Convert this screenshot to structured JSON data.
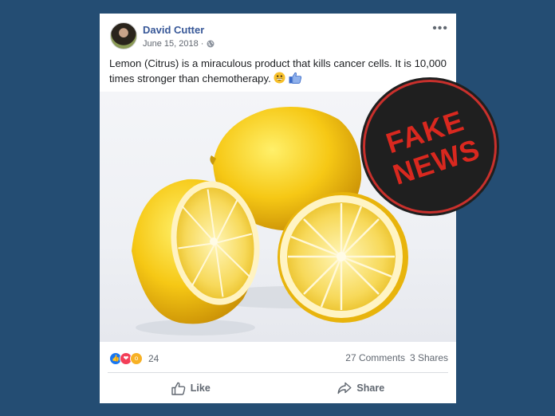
{
  "post": {
    "author": "David Cutter",
    "date": "June 15, 2018 ·",
    "more_label": "•••",
    "text": "Lemon (Citrus) is a miraculous product that kills cancer cells. It is 10,000 times stronger than chemotherapy.",
    "emojis": [
      "grinning-face-icon",
      "thumbs-up-icon"
    ]
  },
  "reactions": {
    "count": "24",
    "icons": [
      "like-reaction-icon",
      "love-reaction-icon",
      "wow-reaction-icon"
    ]
  },
  "stats": {
    "comments": "27 Comments",
    "shares": "3 Shares"
  },
  "actions": {
    "like_label": "Like",
    "share_label": "Share"
  },
  "stamp": {
    "line1": "FAKE",
    "line2": "NEWS",
    "color": "#d9281f"
  }
}
